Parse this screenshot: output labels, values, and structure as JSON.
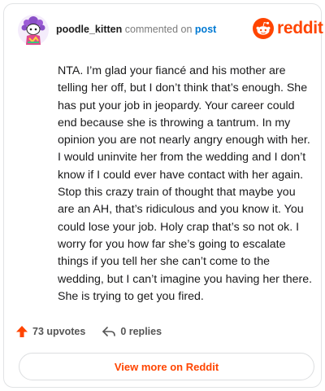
{
  "header": {
    "username": "poodle_kitten",
    "action_text": "commented on",
    "post_link": "post",
    "brand": "reddit"
  },
  "comment": {
    "text": "NTA. I’m glad your fiancé and his mother are telling her off, but I don’t think that’s enough. She has put your job in jeopardy. Your career could end because she is throwing a tantrum. In my opinion you are not nearly angry enough with her. I would uninvite her from the wedding and I don’t know if I could ever have contact with her again. Stop this crazy train of thought that maybe you are an AH, that’s ridiculous and you know it. You could lose your job. Holy crap that’s so not ok. I worry for you how far she’s going to escalate things if you tell her she can’t come to the wedding, but I can’t imagine you having her there. She is trying to get you fired."
  },
  "actions": {
    "upvotes": "73 upvotes",
    "replies": "0 replies"
  },
  "footer": {
    "view_more": "View more on Reddit"
  },
  "colors": {
    "brand": "#ff4500",
    "link": "#0079d3"
  }
}
